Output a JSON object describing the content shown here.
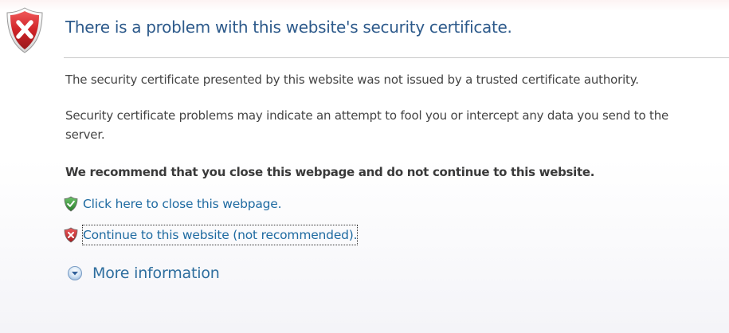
{
  "header": {
    "title": "There is a problem with this website's security certificate."
  },
  "body": {
    "paragraph_1": "The security certificate presented by this website was not issued by a trusted certificate authority.",
    "paragraph_2": "Security certificate problems may indicate an attempt to fool you or intercept any data you send to the server.",
    "recommendation": "We recommend that you close this webpage and do not continue to this website."
  },
  "actions": {
    "close_label": "Click here to close this webpage.",
    "continue_label": "Continue to this website (not recommended).",
    "more_info_label": "More information"
  },
  "icons": {
    "header_icon": "shield-error-icon",
    "close_icon": "shield-check-icon",
    "continue_icon": "shield-error-icon",
    "more_info_icon": "expand-chevron-icon"
  },
  "colors": {
    "title": "#2d5a8b",
    "link": "#1e6aa1",
    "error_shield": "#c8262a",
    "ok_shield": "#3b9a3b"
  }
}
